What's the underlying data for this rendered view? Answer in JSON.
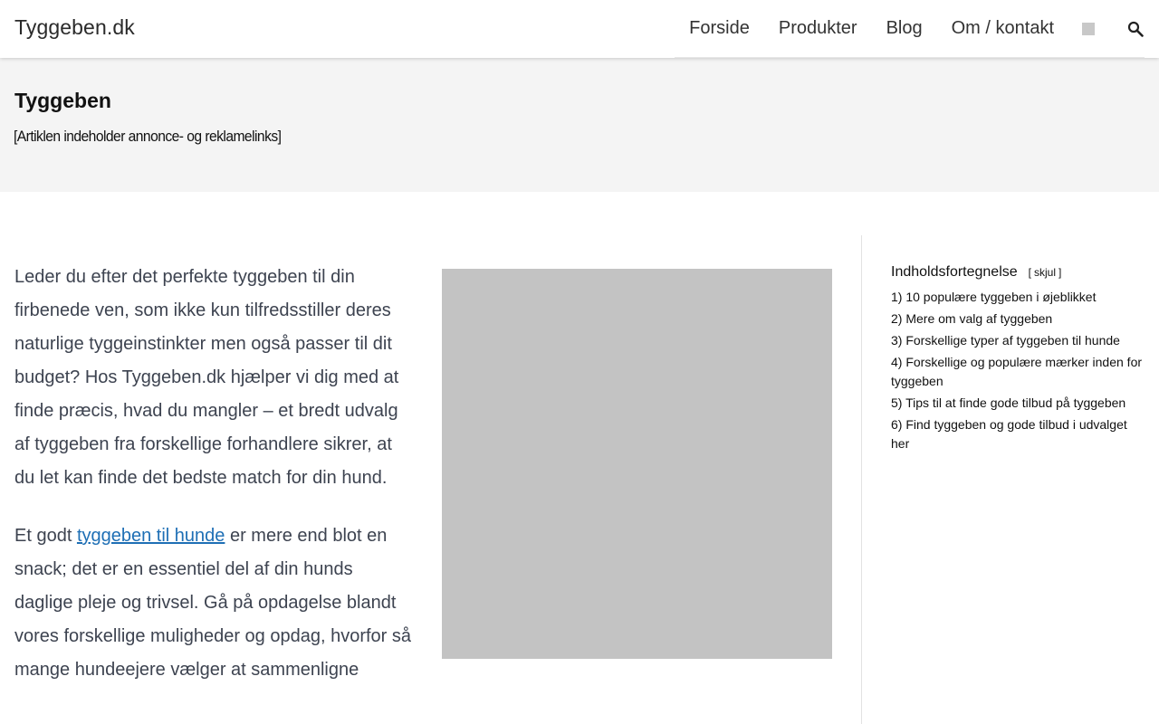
{
  "header": {
    "site_title": "Tyggeben.dk",
    "nav": [
      {
        "label": "Forside"
      },
      {
        "label": "Produkter"
      },
      {
        "label": "Blog"
      },
      {
        "label": "Om / kontakt"
      }
    ],
    "search_icon": "search-icon"
  },
  "hero": {
    "title": "Tyggeben",
    "note": "[Artiklen indeholder annonce- og reklamelinks]"
  },
  "article": {
    "p1": "Leder du efter det perfekte tyggeben til din firbenede ven, som ikke kun tilfredsstiller deres naturlige tyggeinstinkter men også passer til dit budget? Hos Tyggeben.dk hjælper vi dig med at finde præcis, hvad du mangler – et bredt udvalg af tyggeben fra forskellige forhandlere sikrer, at du let kan finde det bedste match for din hund.",
    "p2_before": "Et godt ",
    "p2_link": "tyggeben til hunde",
    "p2_after": " er mere end blot en snack; det er en essentiel del af din hunds daglige pleje og trivsel. Gå på opdagelse blandt vores forskellige muligheder og opdag, hvorfor så mange hundeejere vælger at sammenligne"
  },
  "toc": {
    "title": "Indholdsfortegnelse",
    "toggle_label": "skjul",
    "items": [
      {
        "num": "1)",
        "label": "10 populære tyggeben i øjeblikket"
      },
      {
        "num": "2)",
        "label": "Mere om valg af tyggeben"
      },
      {
        "num": "3)",
        "label": "Forskellige typer af tyggeben til hunde"
      },
      {
        "num": "4)",
        "label": "Forskellige og populære mærker inden for tyggeben"
      },
      {
        "num": "5)",
        "label": "Tips til at finde gode tilbud på tyggeben"
      },
      {
        "num": "6)",
        "label": "Find tyggeben og gode tilbud i udvalget her"
      }
    ]
  },
  "colors": {
    "link": "#1e6fb5",
    "hero_bg": "#f4f4f4",
    "image_placeholder": "#c3c3c3",
    "body_text": "#3d4350"
  }
}
